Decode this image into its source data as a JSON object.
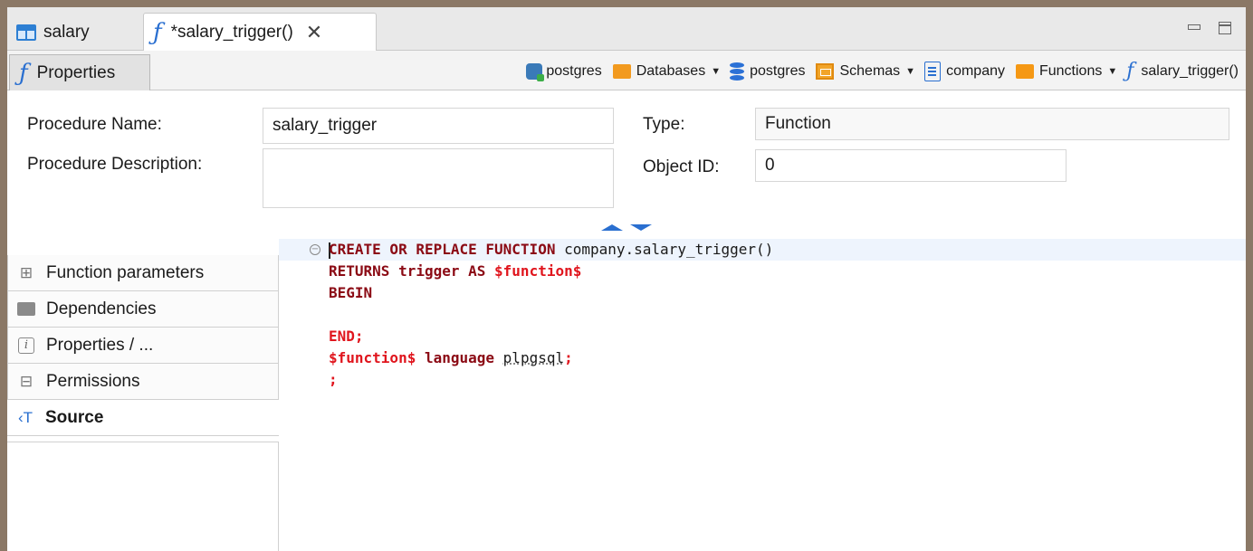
{
  "editor_tabs": [
    {
      "label": "salary",
      "icon": "table-icon",
      "active": false
    },
    {
      "label": "*salary_trigger()",
      "icon": "function-icon",
      "active": true
    }
  ],
  "sub_tab": {
    "label": "Properties",
    "icon": "function-icon"
  },
  "breadcrumb": [
    {
      "label": "postgres",
      "icon": "postgres-connection-icon",
      "dropdown": false
    },
    {
      "label": "Databases",
      "icon": "folder-icon",
      "dropdown": true
    },
    {
      "label": "postgres",
      "icon": "database-icon",
      "dropdown": false
    },
    {
      "label": "Schemas",
      "icon": "schema-icon",
      "dropdown": true
    },
    {
      "label": "company",
      "icon": "schema-doc-icon",
      "dropdown": false
    },
    {
      "label": "Functions",
      "icon": "folder-icon",
      "dropdown": true
    },
    {
      "label": "salary_trigger()",
      "icon": "function-icon",
      "dropdown": false
    }
  ],
  "form": {
    "procedure_name_label": "Procedure Name:",
    "procedure_name_value": "salary_trigger",
    "procedure_description_label": "Procedure Description:",
    "procedure_description_value": "",
    "type_label": "Type:",
    "type_value": "Function",
    "object_id_label": "Object ID:",
    "object_id_value": "0"
  },
  "nav": [
    {
      "label": "Function parameters",
      "icon": "parameters-icon",
      "selected": false
    },
    {
      "label": "Dependencies",
      "icon": "folder-icon",
      "selected": false
    },
    {
      "label": "Properties / ...",
      "icon": "info-icon",
      "selected": false
    },
    {
      "label": "Permissions",
      "icon": "permissions-icon",
      "selected": false
    },
    {
      "label": "Source",
      "icon": "source-icon",
      "selected": true
    }
  ],
  "source_code": {
    "line1": {
      "kw": "CREATE OR REPLACE FUNCTION",
      "rest": " company.salary_trigger()"
    },
    "line2": {
      "kw": "RETURNS trigger AS",
      "str": "$function$"
    },
    "line3": {
      "kw": "BEGIN"
    },
    "line4": {},
    "line5": {
      "str": "END;"
    },
    "line6": {
      "str": "$function$",
      "kw": "language",
      "lang": "plpgsql",
      "end": ";"
    },
    "line7": {
      "str": ";"
    }
  },
  "colors": {
    "keyword": "#8b0a14",
    "string": "#e0151d",
    "accent": "#2a6fd0",
    "current_line": "#eef4fd"
  }
}
